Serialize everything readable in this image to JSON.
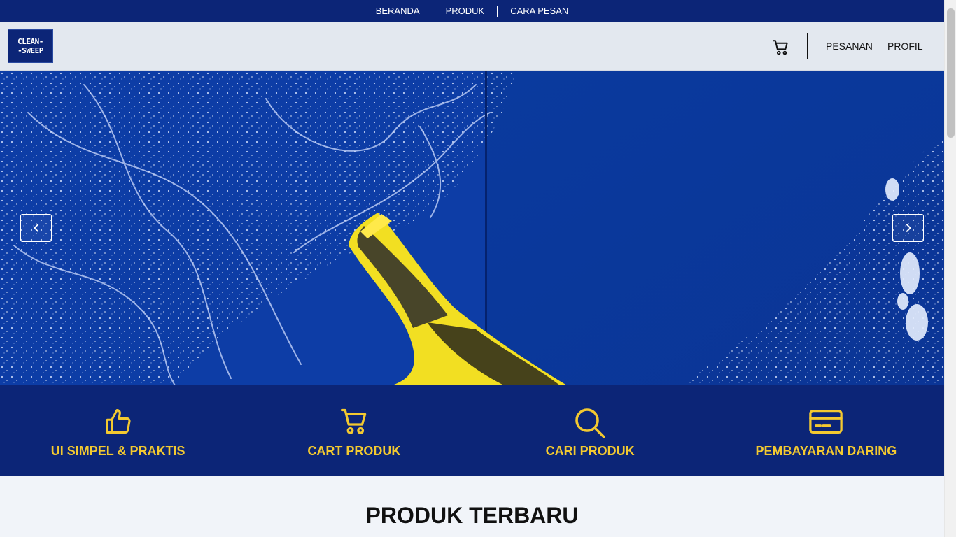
{
  "top_nav": {
    "items": [
      {
        "label": "BERANDA"
      },
      {
        "label": "PRODUK"
      },
      {
        "label": "CARA PESAN"
      }
    ]
  },
  "header": {
    "logo_line1": "CLEAN-",
    "logo_line2": "-SWEEP",
    "cart_icon": "cart-icon",
    "links": {
      "pesanan": "PESANAN",
      "profil": "PROFIL"
    }
  },
  "hero": {
    "prev_icon": "chevron-left-icon",
    "next_icon": "chevron-right-icon"
  },
  "features": [
    {
      "icon": "thumbs-up-icon",
      "label": "UI SIMPEL & PRAKTIS"
    },
    {
      "icon": "cart-icon",
      "label": "CART PRODUK"
    },
    {
      "icon": "search-icon",
      "label": "CARI PRODUK"
    },
    {
      "icon": "credit-card-icon",
      "label": "PEMBAYARAN DARING"
    }
  ],
  "section": {
    "title": "PRODUK TERBARU"
  },
  "colors": {
    "navy": "#0c2577",
    "accent_yellow": "#f3c930",
    "header_bg": "#e3e8ef"
  }
}
